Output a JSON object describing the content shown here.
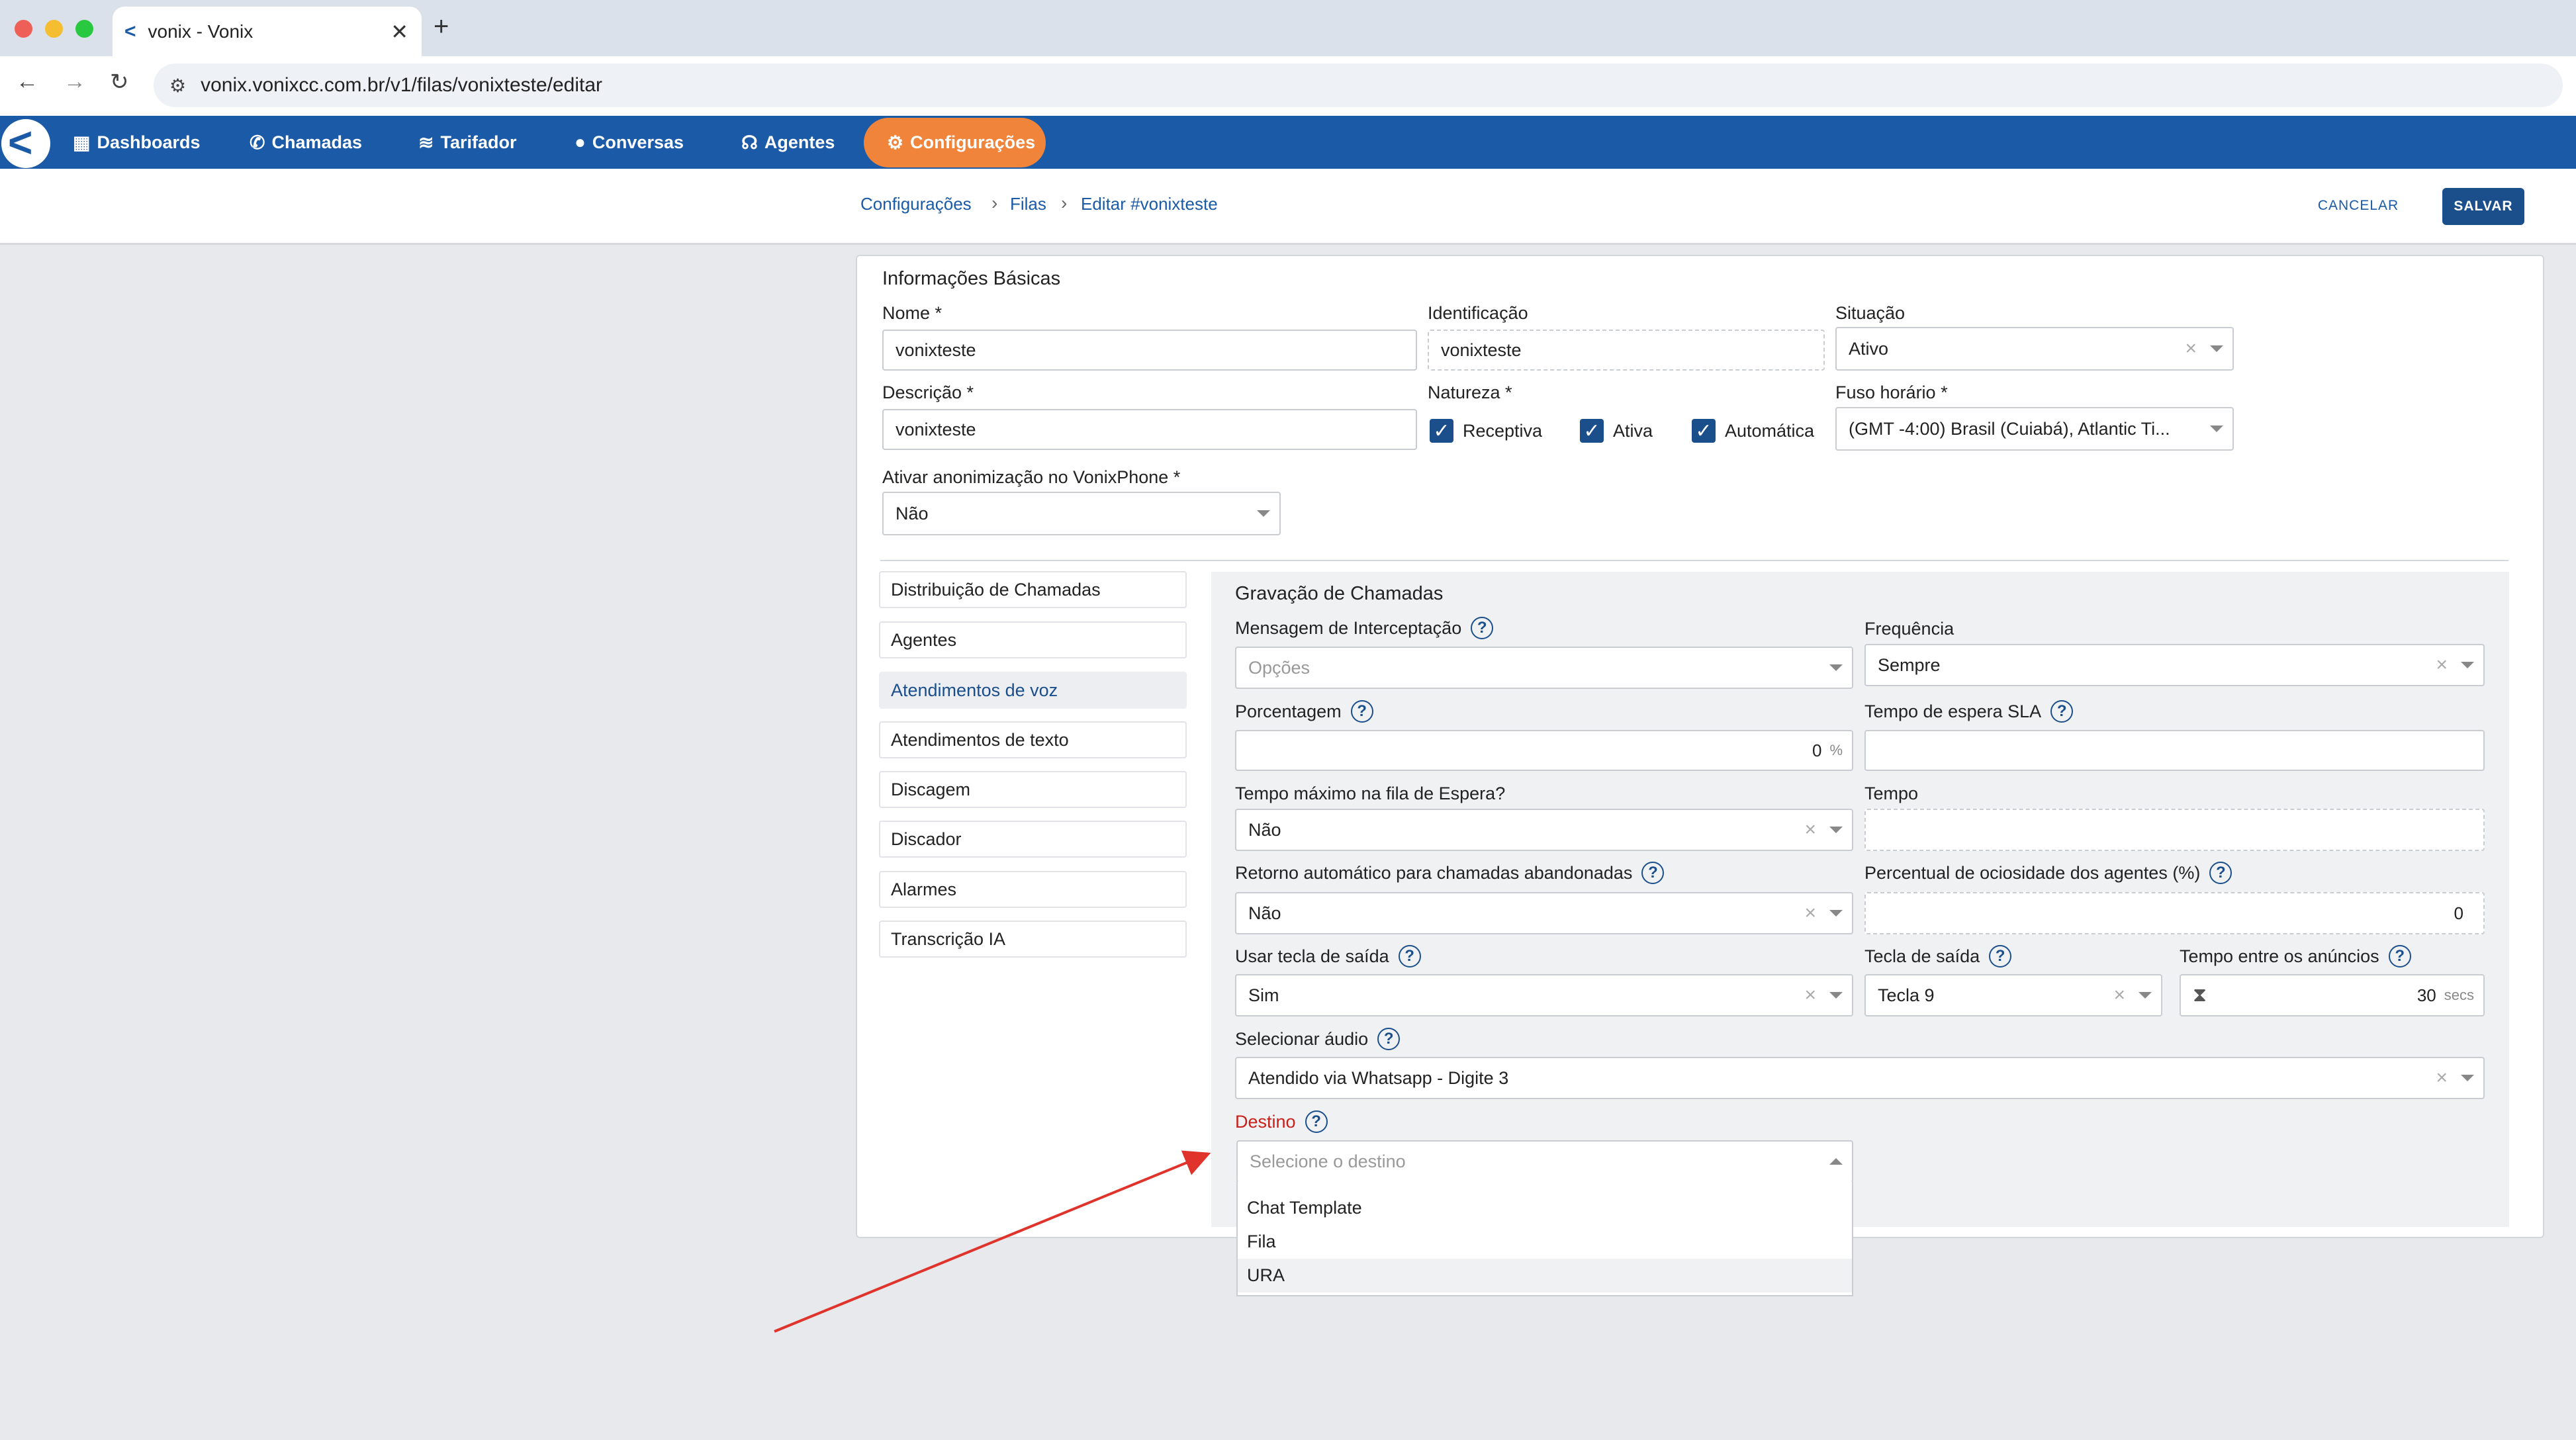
{
  "browser": {
    "tab_title": "vonix - Vonix",
    "tab_close": "✕",
    "new_tab": "+",
    "url": "vonix.vonixcc.com.br/v1/filas/vonixteste/editar"
  },
  "nav": {
    "items": [
      {
        "label": "Dashboards",
        "icon": "dashboard-icon"
      },
      {
        "label": "Chamadas",
        "icon": "phone-icon"
      },
      {
        "label": "Tarifador",
        "icon": "chart-icon"
      },
      {
        "label": "Conversas",
        "icon": "chat-bubble-icon"
      },
      {
        "label": "Agentes",
        "icon": "headset-icon"
      },
      {
        "label": "Configurações",
        "icon": "gear-icon",
        "active": true
      }
    ]
  },
  "breadcrumb": [
    "Configurações",
    "Filas",
    "Editar #vonixteste"
  ],
  "actions": {
    "cancel": "CANCELAR",
    "save": "SALVAR"
  },
  "basic": {
    "section_title": "Informações Básicas",
    "nome_label": "Nome *",
    "nome_value": "vonixteste",
    "ident_label": "Identificação",
    "ident_value": "vonixteste",
    "situacao_label": "Situação",
    "situacao_value": "Ativo",
    "descricao_label": "Descrição *",
    "descricao_value": "vonixteste",
    "natureza_label": "Natureza *",
    "natureza_options": [
      "Receptiva",
      "Ativa",
      "Automática"
    ],
    "fuso_label": "Fuso horário *",
    "fuso_value": "(GMT -4:00) Brasil (Cuiabá), Atlantic Ti...",
    "anon_label": "Ativar anonimização no VonixPhone *",
    "anon_value": "Não"
  },
  "sidebar": {
    "items": [
      "Distribuição de Chamadas",
      "Agentes",
      "Atendimentos de voz",
      "Atendimentos de texto",
      "Discagem",
      "Discador",
      "Alarmes",
      "Transcrição IA"
    ],
    "active_index": 2
  },
  "gravacao": {
    "title": "Gravação de Chamadas",
    "msg_label": "Mensagem de Interceptação",
    "msg_placeholder": "Opções",
    "freq_label": "Frequência",
    "freq_value": "Sempre",
    "porc_label": "Porcentagem",
    "porc_value": "0",
    "porc_unit": "%",
    "sla_label": "Tempo de espera SLA",
    "sla_value": "",
    "tmax_label": "Tempo máximo na fila de Espera?",
    "tmax_value": "Não",
    "tempo_label": "Tempo",
    "tempo_value": "",
    "retorno_label": "Retorno automático para chamadas abandonadas",
    "retorno_value": "Não",
    "ociosidade_label": "Percentual de ociosidade dos agentes (%)",
    "ociosidade_value": "0",
    "usar_tecla_label": "Usar tecla de saída",
    "usar_tecla_value": "Sim",
    "tecla_label": "Tecla de saída",
    "tecla_value": "Tecla 9",
    "anuncios_label": "Tempo entre os anúncios",
    "anuncios_value": "30",
    "anuncios_unit": "secs",
    "audio_label": "Selecionar áudio",
    "audio_value": "Atendido via Whatsapp - Digite 3",
    "destino_label": "Destino",
    "destino_placeholder": "Selecione o destino",
    "destino_options": [
      "Chat Template",
      "Fila",
      "URA"
    ],
    "destino_highlight_index": 2
  },
  "colors": {
    "brand": "#1b5aa6",
    "accent": "#f0843a",
    "error": "#c8201b",
    "annotation_arrow": "#e0332b"
  }
}
